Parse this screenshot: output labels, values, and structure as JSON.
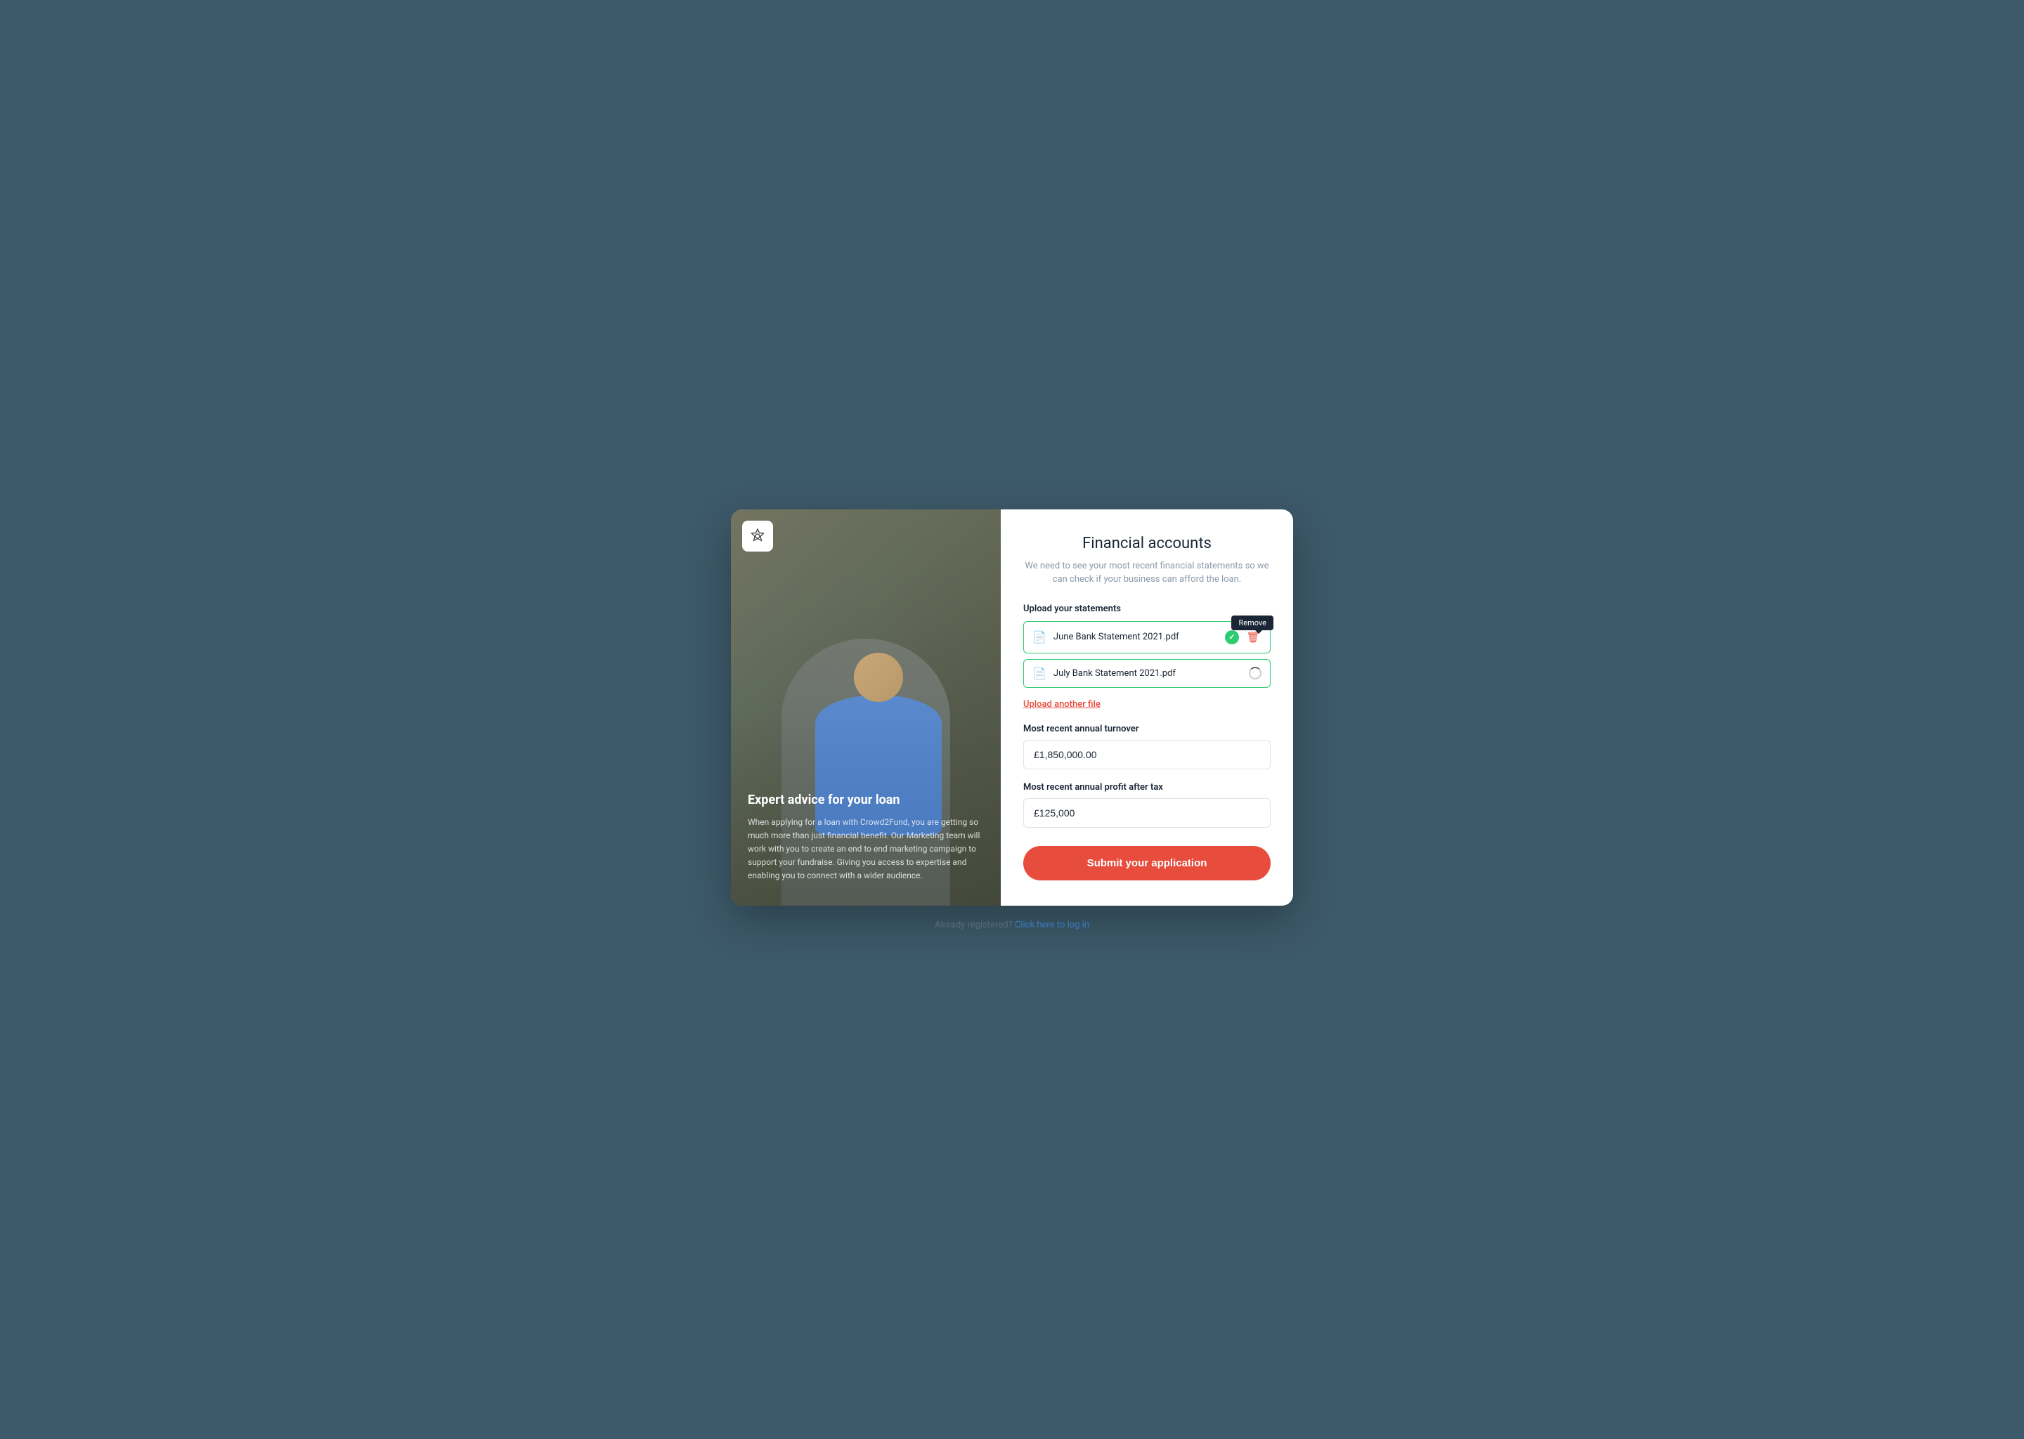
{
  "modal": {
    "left": {
      "logo_alt": "Crowd2Fund logo",
      "heading": "Expert advice for your loan",
      "description": "When applying for a loan with Crowd2Fund, you are getting so much more than just financial benefit. Our Marketing team will work with you to create an end to end marketing campaign to support your fundraise. Giving you access to expertise and enabling you to connect with a wider audience."
    },
    "right": {
      "title": "Financial accounts",
      "subtitle": "We need to see your most recent financial statements so we can check if your business can afford the loan.",
      "upload_section_label": "Upload your statements",
      "tooltip_remove_label": "Remove",
      "files": [
        {
          "name": "June Bank Statement 2021.pdf",
          "status": "done"
        },
        {
          "name": "July Bank Statement 2021.pdf",
          "status": "uploading"
        }
      ],
      "upload_another_label": "Upload another file",
      "turnover_label": "Most recent annual turnover",
      "turnover_value": "£1,850,000.00",
      "profit_label": "Most recent annual profit after tax",
      "profit_value": "£125,000",
      "submit_label": "Submit your application"
    }
  },
  "footer": {
    "already_registered": "Already registered?",
    "login_link": "Click here to log in"
  }
}
